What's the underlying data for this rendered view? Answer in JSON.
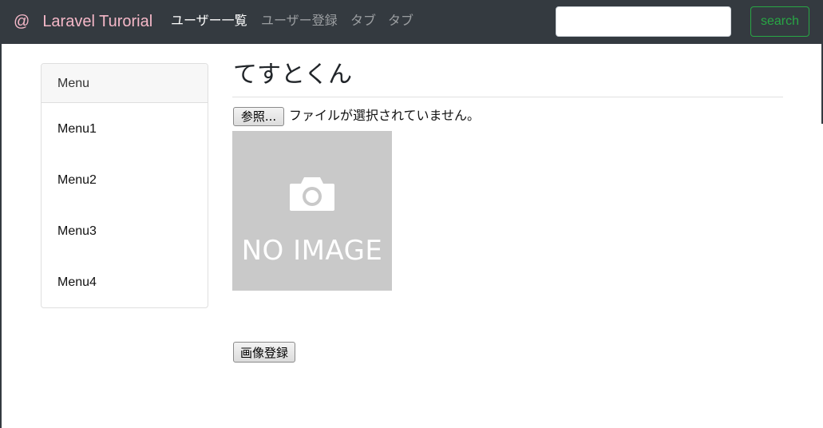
{
  "navbar": {
    "brand_icon": "@",
    "brand_label": "Laravel Turorial",
    "items": [
      {
        "label": "ユーザー一覧",
        "active": true
      },
      {
        "label": "ユーザー登録",
        "active": false
      },
      {
        "label": "タブ",
        "active": false
      },
      {
        "label": "タブ",
        "active": false
      }
    ],
    "search": {
      "value": "",
      "placeholder": ""
    },
    "search_button": "search"
  },
  "sidebar": {
    "header": "Menu",
    "items": [
      {
        "label": "Menu1"
      },
      {
        "label": "Menu2"
      },
      {
        "label": "Menu3"
      },
      {
        "label": "Menu4"
      }
    ]
  },
  "main": {
    "title": "てすとくん",
    "file_button": "参照...",
    "file_status": "ファイルが選択されていません。",
    "noimage_label": "NO IMAGE",
    "submit_button": "画像登録"
  },
  "colors": {
    "navbar_bg": "#343a40",
    "brand": "#f5b8c8",
    "search_accent": "#28a745",
    "placeholder_bg": "#c9c9c9"
  }
}
